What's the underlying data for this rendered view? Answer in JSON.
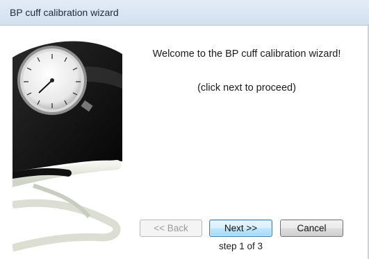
{
  "window": {
    "title": "BP cuff calibration wizard"
  },
  "content": {
    "welcome_text": "Welcome to the BP cuff calibration wizard!",
    "hint_text": "(click next to proceed)"
  },
  "buttons": {
    "back_label": "<< Back",
    "back_enabled": false,
    "next_label": "Next >>",
    "cancel_label": "Cancel"
  },
  "status": {
    "step_text": "step 1 of 3"
  },
  "side_image": {
    "icon": "sphygmomanometer-image"
  },
  "colors": {
    "titlebar": "#d2e0ef",
    "next_button_border": "#3c7fb1",
    "disabled_text": "#9a9a9a"
  }
}
